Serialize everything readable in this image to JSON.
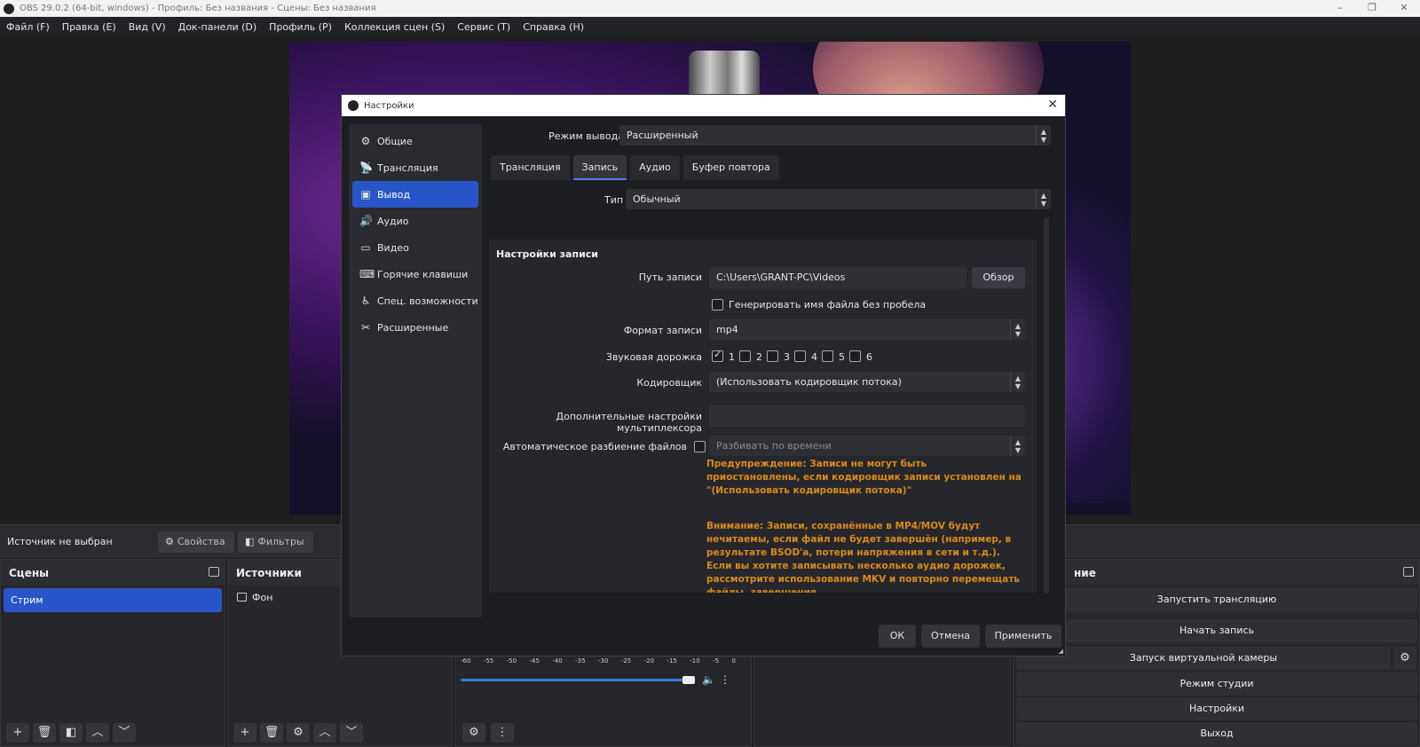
{
  "window": {
    "title": "OBS 29.0.2 (64-bit, windows) - Профиль: Без названия - Сцены: Без названия",
    "controls": [
      "–",
      "❐",
      "✕"
    ]
  },
  "menu": [
    "Файл (F)",
    "Правка (E)",
    "Вид (V)",
    "Док-панели (D)",
    "Профиль (P)",
    "Коллекция сцен (S)",
    "Сервис (T)",
    "Справка (H)"
  ],
  "source_bar": {
    "status": "Источник не выбран",
    "properties": "Свойства",
    "filters": "Фильтры"
  },
  "scenes": {
    "title": "Сцены",
    "items": [
      "Стрим"
    ]
  },
  "sources": {
    "title": "Источники",
    "items": [
      "Фон"
    ]
  },
  "mixer": {
    "ticks": [
      "-60",
      "-55",
      "-50",
      "-45",
      "-40",
      "-35",
      "-30",
      "-25",
      "-20",
      "-15",
      "-10",
      "-5",
      "0"
    ]
  },
  "controls": {
    "title": "ние",
    "start_stream": "Запустить трансляцию",
    "start_record": "Начать запись",
    "virtual_cam": "Запуск виртуальной камеры",
    "studio_mode": "Режим студии",
    "settings": "Настройки",
    "exit": "Выход"
  },
  "dialog": {
    "title": "Настройки",
    "nav": [
      {
        "label": "Общие",
        "icon": "gear-icon",
        "active": false
      },
      {
        "label": "Трансляция",
        "icon": "antenna-icon",
        "active": false
      },
      {
        "label": "Вывод",
        "icon": "output-icon",
        "active": true
      },
      {
        "label": "Аудио",
        "icon": "speaker-icon",
        "active": false
      },
      {
        "label": "Видео",
        "icon": "monitor-icon",
        "active": false
      },
      {
        "label": "Горячие клавиши",
        "icon": "keyboard-icon",
        "active": false
      },
      {
        "label": "Спец. возможности",
        "icon": "accessibility-icon",
        "active": false
      },
      {
        "label": "Расширенные",
        "icon": "tools-icon",
        "active": false
      }
    ],
    "output_mode_label": "Режим вывода",
    "output_mode_value": "Расширенный",
    "tabs": [
      "Трансляция",
      "Запись",
      "Аудио",
      "Буфер повтора"
    ],
    "active_tab": "Запись",
    "type_label": "Тип",
    "type_value": "Обычный",
    "group_title": "Настройки записи",
    "path_label": "Путь записи",
    "path_value": "C:\\Users\\GRANT-PC\\Videos",
    "browse": "Обзор",
    "no_space_label": "Генерировать имя файла без пробела",
    "format_label": "Формат записи",
    "format_value": "mp4",
    "tracks_label": "Звуковая дорожка",
    "tracks": [
      "1",
      "2",
      "3",
      "4",
      "5",
      "6"
    ],
    "encoder_label": "Кодировщик",
    "encoder_value": "(Использовать кодировщик потока)",
    "muxer_label": "Дополнительные настройки мультиплексора",
    "muxer_value": "",
    "split_label": "Автоматическое разбиение файлов",
    "split_value": "Разбивать по времени",
    "warning1": "Предупреждение: Записи не могут быть приостановлены, если кодировщик записи установлен на \"(Использовать кодировщик потока)\"",
    "warning2": "Внимание: Записи, сохранённые в MP4/MOV будут нечитаемы, если файл не будет завершён (например, в результате BSOD'а, потери напряжения в сети и т.д.). Если вы хотите записывать несколько аудио дорожек, рассмотрите использование MKV и повторно перемещать файлы, завершения",
    "ok": "ОК",
    "cancel": "Отмена",
    "apply": "Применить"
  },
  "colors": {
    "accent": "#2856c8",
    "warning": "#d98a1a",
    "background": "#1e1e1e"
  }
}
